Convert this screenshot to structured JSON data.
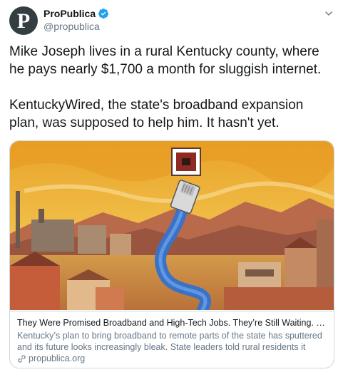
{
  "account": {
    "avatar_glyph": "P",
    "display_name": "ProPublica",
    "handle": "@propublica",
    "verified": true
  },
  "tweet": {
    "text": "Mike Joseph lives in a rural Kentucky county, where he pays nearly $1,700 a month for sluggish internet.\n\nKentuckyWired, the state's broadband expansion plan, was supposed to help him. It hasn't yet."
  },
  "card": {
    "title": "They Were Promised Broadband and High-Tech Jobs. They’re Still Waiting. — ProPublica",
    "description": "Kentucky’s plan to bring broadband to remote parts of the state has sputtered and its future looks increasingly bleak. State leaders told rural residents it would…",
    "domain": "propublica.org",
    "image_icon": "illustration-ethernet-cable-over-kentucky-town"
  },
  "colors": {
    "verified_blue": "#1da1f2",
    "secondary_text": "#657786",
    "border": "#ccd6dd",
    "avatar_bg": "#333d42"
  },
  "icons": [
    "verified-badge-icon",
    "chevron-down-icon",
    "link-icon"
  ]
}
